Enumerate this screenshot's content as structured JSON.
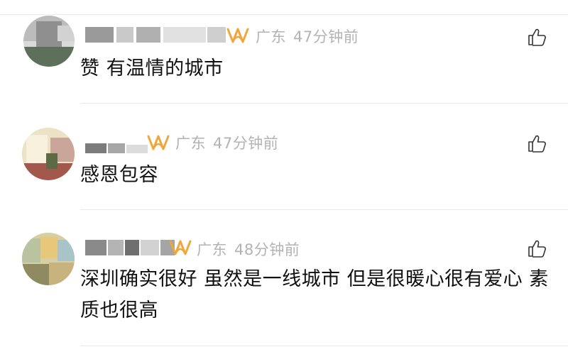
{
  "comments": [
    {
      "region": "广东",
      "time": "47分钟前",
      "text": "赞 有温情的城市"
    },
    {
      "region": "广东",
      "time": "47分钟前",
      "text": "感恩包容"
    },
    {
      "region": "广东",
      "time": "48分钟前",
      "text": "深圳确实很好 虽然是一线城市 但是很暖心很有爱心 素质也很高"
    }
  ],
  "icons": {
    "vip": "vip-badge-icon",
    "like": "thumbs-up-icon"
  },
  "colors": {
    "meta_text": "#b3b3b3",
    "comment_text": "#111111",
    "vip_badge": "#f0a63a",
    "divider": "#e8e8e8"
  }
}
